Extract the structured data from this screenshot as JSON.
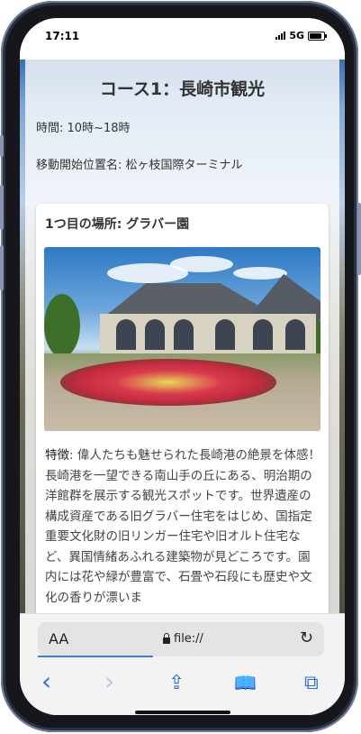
{
  "status": {
    "time": "17:11",
    "network": "5G"
  },
  "page": {
    "course_title": "コース1：長崎市観光",
    "time_info": "時間: 10時~18時",
    "start_info": "移動開始位置名: 松ヶ枝国際ターミナル",
    "card": {
      "title": "1つ目の場所: グラバー園",
      "feature_label": "特徴",
      "feature_text": ": 偉人たちも魅せられた長崎港の絶景を体感！",
      "description": "長崎港を一望できる南山手の丘にある、明治期の洋館群を展示する観光スポットです。世界遺産の構成資産である旧グラバー住宅をはじめ、国指定重要文化財の旧リンガー住宅や旧オルト住宅など、異国情緒あふれる建築物が見どころです。園内には花や緑が豊富で、石畳や石段にも歴史や文化の香りが漂いま"
    }
  },
  "browser": {
    "text_size_label": "AA",
    "url": "file://",
    "toolbar": {
      "back": "‹",
      "forward": "›",
      "share": "⇪",
      "bookmarks": "📖",
      "tabs": "⧉"
    }
  },
  "colors": {
    "accent": "#2f6fcf",
    "text": "#333333"
  }
}
